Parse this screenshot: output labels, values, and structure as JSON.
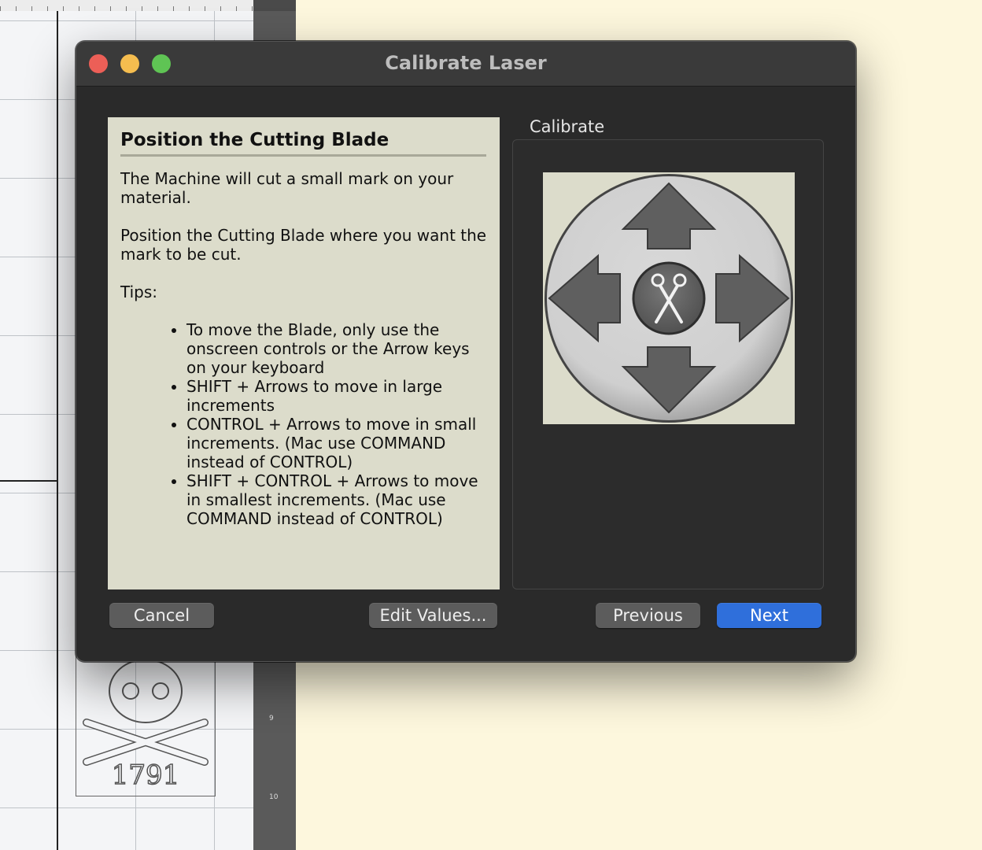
{
  "window": {
    "title": "Calibrate Laser"
  },
  "info": {
    "heading": "Position the Cutting Blade",
    "paragraph1": "The Machine will cut a small mark on your material.",
    "paragraph2": "Position the Cutting Blade where you want the mark to be cut.",
    "tips_label": "Tips:",
    "tips": [
      "To move the Blade, only use the onscreen controls or the Arrow keys on your keyboard",
      "SHIFT + Arrows to move in large increments",
      "CONTROL + Arrows to move in small increments. (Mac use COMMAND instead of CONTROL)",
      "SHIFT + CONTROL + Arrows to move in smallest increments. (Mac use COMMAND instead of CONTROL)"
    ]
  },
  "calibrate": {
    "label": "Calibrate",
    "controls": {
      "up": "arrow-up-icon",
      "down": "arrow-down-icon",
      "left": "arrow-left-icon",
      "right": "arrow-right-icon",
      "center": "scissors-icon"
    }
  },
  "buttons": {
    "cancel": "Cancel",
    "edit_values": "Edit Values...",
    "previous": "Previous",
    "next": "Next"
  },
  "background": {
    "ruler_numbers": [
      "9",
      "10"
    ],
    "design_text": "1791"
  },
  "colors": {
    "desktop": "#fdf7dd",
    "window_bg": "#2a2a2a",
    "info_panel": "#dcdccb",
    "accent_button": "#2f6fdb",
    "close": "#ec5f57",
    "minimize": "#f5bd4f",
    "maximize": "#5fc454"
  }
}
